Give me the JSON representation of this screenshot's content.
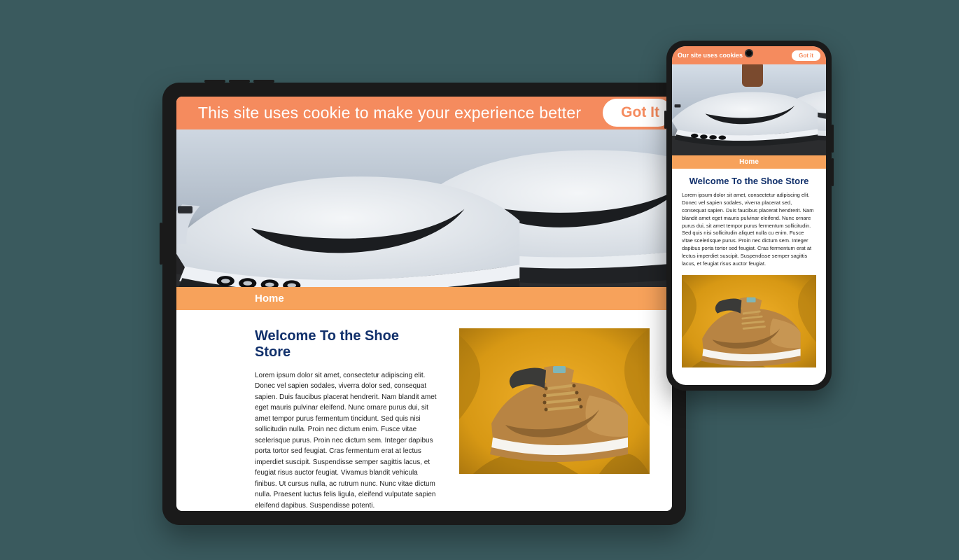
{
  "desktop": {
    "cookie_message": "This site uses cookie to make your experience better",
    "cookie_button": "Got It",
    "nav_home": "Home",
    "heading": "Welcome To the Shoe Store",
    "body": "Lorem ipsum dolor sit amet, consectetur adipiscing elit. Donec vel sapien sodales, viverra dolor sed, consequat sapien. Duis faucibus placerat hendrerit. Nam blandit amet eget mauris pulvinar eleifend. Nunc ornare purus dui, sit amet tempor purus fermentum tincidunt. Sed quis nisi sollicitudin nulla. Proin nec dictum enim. Fusce vitae scelerisque purus. Proin nec dictum sem. Integer dapibus porta tortor sed feugiat. Cras fermentum erat at lectus imperdiet suscipit. Suspendisse semper sagittis lacus, et feugiat risus auctor feugiat. Vivamus blandit vehicula finibus. Ut cursus nulla, ac rutrum nunc. Nunc vitae dictum nulla. Praesent luctus felis ligula, eleifend vulputate sapien eleifend dapibus. Suspendisse potenti."
  },
  "mobile": {
    "cookie_message": "Our site uses cookies",
    "cookie_button": "Got it",
    "nav_home": "Home",
    "heading": "Welcome To the Shoe Store",
    "body": "Lorem ipsum dolor sit amet, consectetur adipiscing elit. Donec vel sapien sodales, viverra placerat sed, consequat sapien. Duis faucibus placerat hendrerit. Nam blandit amet eget mauris pulvinar eleifend. Nunc ornare purus dui, sit amet tempor purus fermentum sollicitudin. Sed quis nisi sollicitudin aliquet nulla cu enim. Fusce vitae scelerisque purus. Proin nec dictum sem. Integer dapibus porta tortor sed feugiat. Cras fermentum erat at lectus imperdiet suscipit. Suspendisse semper sagittis lacus, et feugiat risus auctor feugiat."
  },
  "colors": {
    "accent": "#f58b5e",
    "nav": "#f7a25b",
    "heading": "#11306b"
  }
}
